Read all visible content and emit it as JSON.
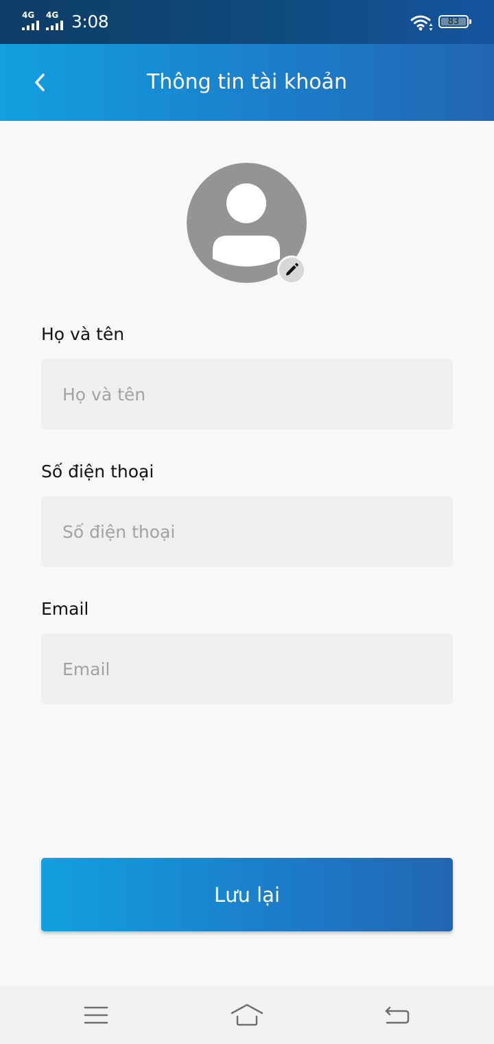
{
  "status_bar": {
    "network_1": "4G",
    "network_2": "4G",
    "time": "3:08",
    "battery": "83",
    "icons": [
      "signal-icon",
      "signal-icon",
      "wifi-icon",
      "battery-icon"
    ]
  },
  "header": {
    "title": "Thông tin tài khoản",
    "back_icon": "chevron-left-icon"
  },
  "avatar": {
    "placeholder_icon": "user-icon",
    "edit_icon": "pencil-icon"
  },
  "form": {
    "fields": [
      {
        "label": "Họ và tên",
        "value": "",
        "placeholder": "Họ và tên"
      },
      {
        "label": "Số điện thoại",
        "value": "",
        "placeholder": "Số điện thoại"
      },
      {
        "label": "Email",
        "value": "",
        "placeholder": "Email"
      }
    ],
    "save_label": "Lưu lại"
  },
  "nav_bar": {
    "icons": [
      "menu-icon",
      "home-icon",
      "back-icon"
    ]
  },
  "colors": {
    "accent_start": "#12a0e0",
    "accent_end": "#2266b2",
    "status_bar": "#0f4a7c",
    "input_bg": "#efefef",
    "avatar_gray": "#949494",
    "page_bg": "#f8f8f8"
  }
}
